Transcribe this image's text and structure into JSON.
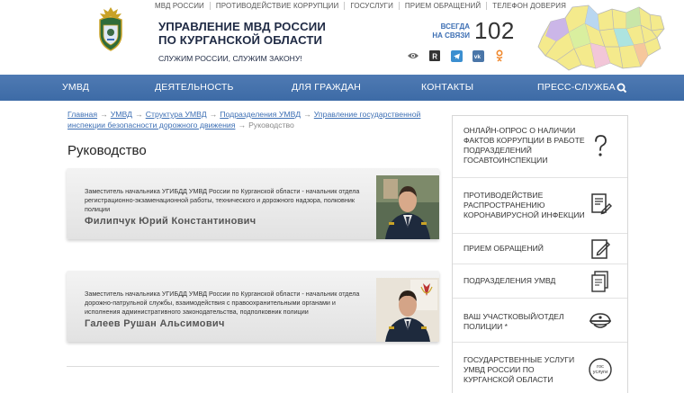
{
  "top_links": [
    "МВД РОССИИ",
    "ПРОТИВОДЕЙСТВИЕ КОРРУПЦИИ",
    "ГОСУСЛУГИ",
    "ПРИЕМ ОБРАЩЕНИЙ",
    "ТЕЛЕФОН ДОВЕРИЯ"
  ],
  "header": {
    "title_line1": "УПРАВЛЕНИЕ МВД РОССИИ",
    "title_line2": "ПО КУРГАНСКОЙ ОБЛАСТИ",
    "slogan": "СЛУЖИМ РОССИИ, СЛУЖИМ ЗАКОНУ!",
    "always_line1": "ВСЕГДА",
    "always_line2": "НА СВЯЗИ",
    "phone": "102",
    "social_icons": [
      "eye-icon",
      "rutube-icon",
      "telegram-icon",
      "vk-icon",
      "odnoklassniki-icon"
    ]
  },
  "nav": {
    "items": [
      "УМВД",
      "ДЕЯТЕЛЬНОСТЬ",
      "ДЛЯ ГРАЖДАН",
      "КОНТАКТЫ",
      "ПРЕСС-СЛУЖБА"
    ],
    "search_icon": "search-icon"
  },
  "breadcrumb": {
    "items": [
      "Главная",
      "УМВД",
      "Структура УМВД",
      "Подразделения УМВД",
      "Управление государственной инспекции безопасности дорожного движения"
    ],
    "current": "Руководство",
    "separator": "→"
  },
  "page_title": "Руководство",
  "staff": [
    {
      "position": "Заместитель начальника УГИБДД УМВД России по Курганской области - начальник отдела регистрационно-экзаменационной работы, технического и дорожного надзора, полковник полиции",
      "name": "Филипчук Юрий Константинович"
    },
    {
      "position": "Заместитель начальника УГИБДД УМВД России по Курганской области - начальник отдела дорожно-патрульной службы, взаимодействия с правоохранительными органами и исполнения административного законодательства, подполковник полиции",
      "name": "Галеев Рушан Альсимович"
    }
  ],
  "sidebar": {
    "items": [
      {
        "label": "ОНЛАЙН-ОПРОС О НАЛИЧИИ ФАКТОВ КОРРУПЦИИ В РАБОТЕ ПОДРАЗДЕЛЕНИЙ ГОСАВТОИНСПЕКЦИИ",
        "icon": "question-icon"
      },
      {
        "label": "ПРОТИВОДЕЙСТВИЕ РАСПРОСТРАНЕНИЮ КОРОНАВИРУСНОЙ ИНФЕКЦИИ",
        "icon": "document-pen-icon"
      },
      {
        "label": "ПРИЕМ ОБРАЩЕНИЙ",
        "icon": "edit-icon"
      },
      {
        "label": "ПОДРАЗДЕЛЕНИЯ УМВД",
        "icon": "documents-icon"
      },
      {
        "label": "ВАШ УЧАСТКОВЫЙ/ОТДЕЛ ПОЛИЦИИ *",
        "icon": "police-cap-icon"
      },
      {
        "label": "ГОСУДАРСТВЕННЫЕ УСЛУГИ УМВД РОССИИ ПО КУРГАНСКОЙ ОБЛАСТИ",
        "icon": "gosuslugi-icon"
      }
    ],
    "gosuslugi_badge": "гос услуги"
  },
  "colors": {
    "nav_blue": "#4673ad",
    "link_blue": "#3d6fb4",
    "title_navy": "#1f2a44"
  }
}
